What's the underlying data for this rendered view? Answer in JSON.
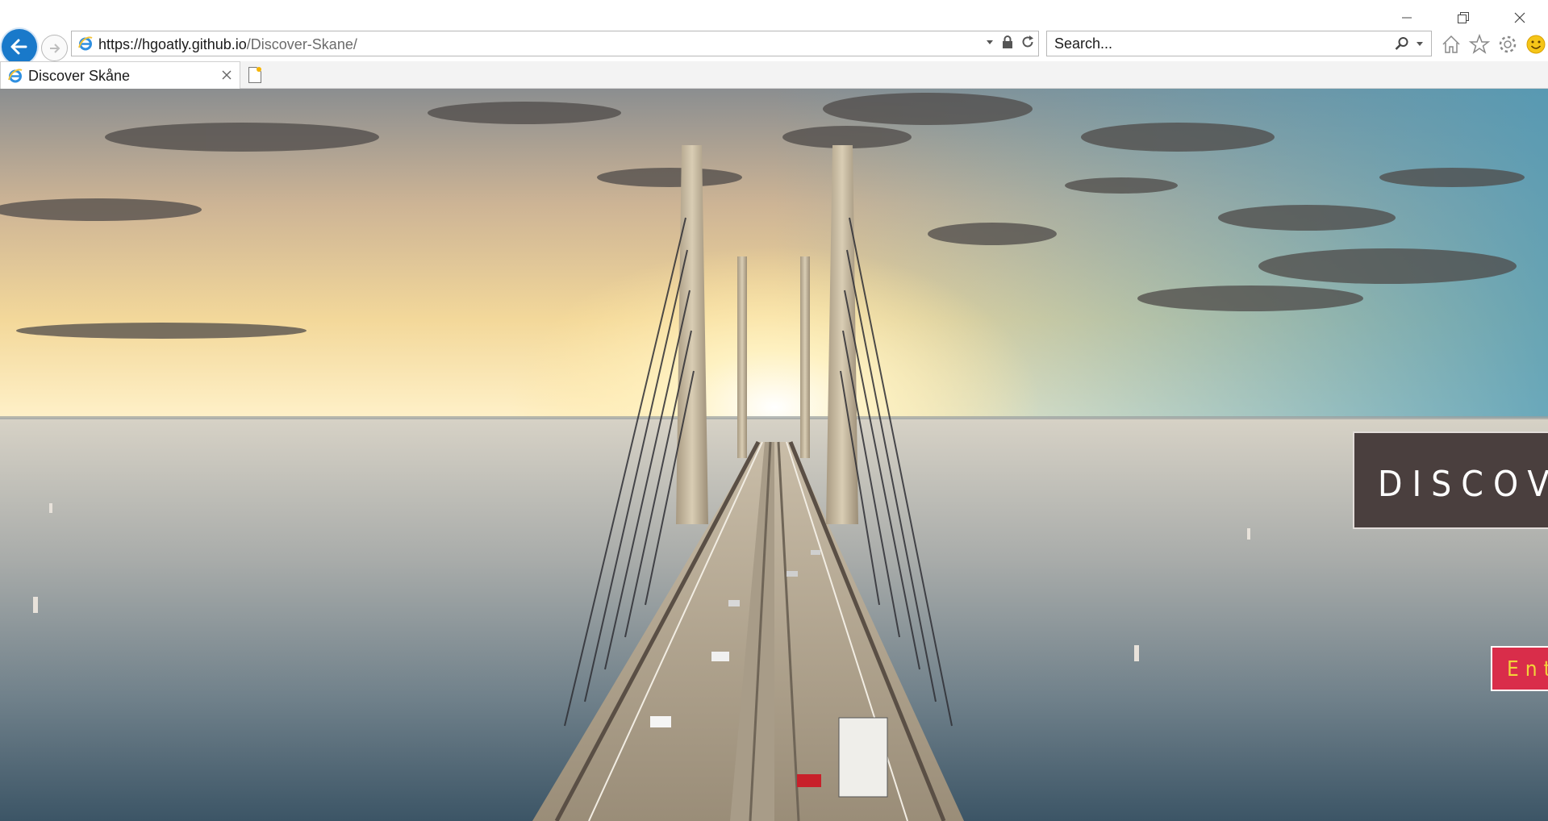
{
  "browser": {
    "address_bar": {
      "domain": "https://hgoatly.github.io",
      "path": "/Discover-Skane/"
    },
    "search": {
      "placeholder": "Search..."
    },
    "tabs": [
      {
        "label": "Discover Skåne"
      }
    ],
    "window_controls": [
      "minimize-icon",
      "restore-icon",
      "close-icon"
    ],
    "toolbar_icons": [
      "home-icon",
      "star-icon",
      "gear-icon",
      "smiley-icon"
    ]
  },
  "page": {
    "hero": {
      "image": "Aerial photo of a cable-stayed bridge over the sea at sunset"
    },
    "discover_heading": "DISCOVE",
    "enter_button_label": "Ent"
  },
  "colors": {
    "accent": "#1979ca",
    "heading_box": "#4a3f3e",
    "enter_button": "#d92d4a",
    "enter_text": "#f2d33a"
  }
}
